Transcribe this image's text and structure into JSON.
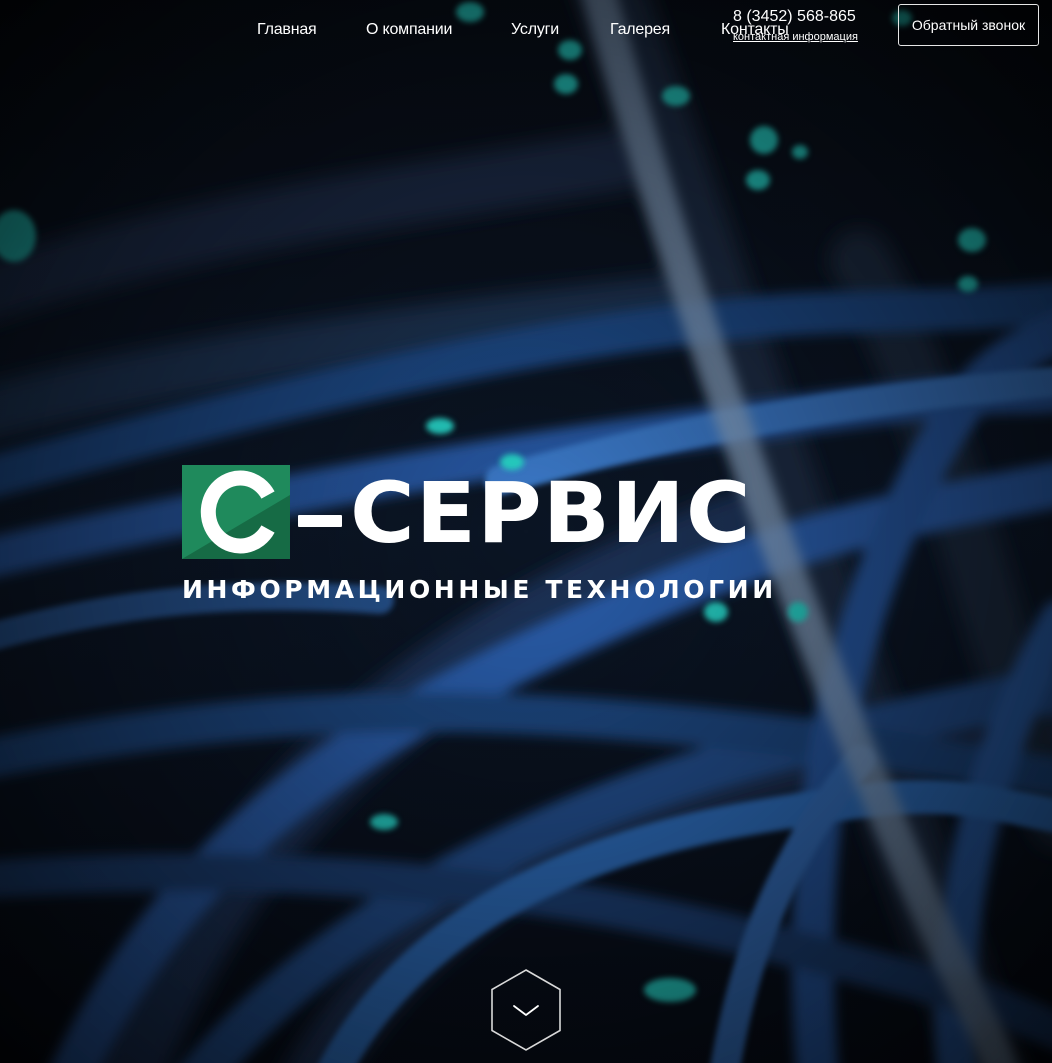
{
  "nav": {
    "items": [
      {
        "label": "Главная"
      },
      {
        "label": "О компании"
      },
      {
        "label": "Услуги"
      },
      {
        "label": "Галерея"
      },
      {
        "label": "Контакты"
      }
    ]
  },
  "header": {
    "phone": "8 (3452) 568-865",
    "contact_info_label": "контактная информация",
    "callback_label": "Обратный звонок"
  },
  "logo": {
    "mark_letter": "С",
    "word": "СЕРВИС",
    "tagline": "ИНФОРМАЦИОННЫЕ ТЕХНОЛОГИИ"
  },
  "icons": {
    "scroll_down": "chevron-down-icon"
  },
  "colors": {
    "logo_green": "#1f8a5c",
    "logo_green_dark": "#166b45",
    "cable_blue": "#2f6fb5",
    "led_cyan": "#27d6c8",
    "background": "#05080d"
  }
}
